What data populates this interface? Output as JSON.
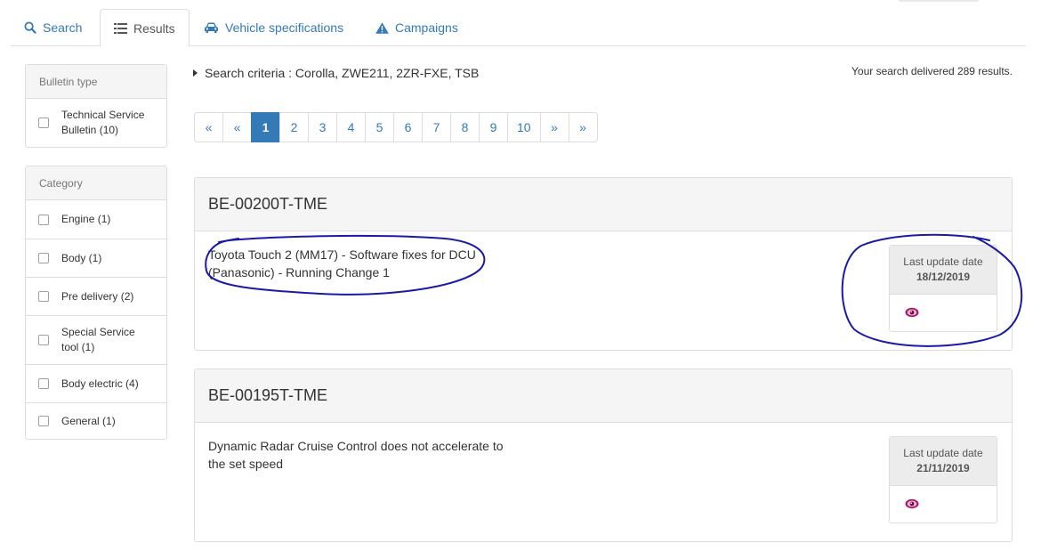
{
  "tabs": [
    {
      "label": "Search",
      "icon": "search-icon"
    },
    {
      "label": "Results",
      "icon": "list-icon"
    },
    {
      "label": "Vehicle specifications",
      "icon": "car-icon"
    },
    {
      "label": "Campaigns",
      "icon": "warning-icon"
    }
  ],
  "active_tab": "Results",
  "sidebar": {
    "bulletin_type": {
      "title": "Bulletin type",
      "items": [
        {
          "label": "Technical Service Bulletin (10)",
          "checked": false
        }
      ]
    },
    "category": {
      "title": "Category",
      "items": [
        {
          "label": "Engine (1)",
          "checked": false
        },
        {
          "label": "Body (1)",
          "checked": false
        },
        {
          "label": "Pre delivery (2)",
          "checked": false
        },
        {
          "label": "Special Service tool (1)",
          "checked": false
        },
        {
          "label": "Body electric (4)",
          "checked": false
        },
        {
          "label": "General (1)",
          "checked": false
        }
      ]
    }
  },
  "search_criteria": "Search criteria : Corolla, ZWE211, 2ZR-FXE, TSB",
  "results_count": "Your search delivered 289 results.",
  "pagination": {
    "first": "«",
    "prev": "«",
    "pages": [
      "1",
      "2",
      "3",
      "4",
      "5",
      "6",
      "7",
      "8",
      "9",
      "10"
    ],
    "current": "1",
    "next": "»",
    "last": "»"
  },
  "bulletins": [
    {
      "id": "BE-00200T-TME",
      "description": "Toyota Touch 2 (MM17) - Software fixes for DCU (Panasonic) - Running Change 1",
      "date_label": "Last update date",
      "date": "18/12/2019"
    },
    {
      "id": "BE-00195T-TME",
      "description": "Dynamic Radar Cruise Control does not accelerate to the set speed",
      "date_label": "Last update date",
      "date": "21/11/2019"
    }
  ],
  "colors": {
    "link": "#337ab7",
    "active_page": "#337ab7",
    "border": "#dddddd",
    "panel_header": "#f5f5f5",
    "eye_icon": "#b0176b",
    "annotation": "#1a1aa6"
  }
}
